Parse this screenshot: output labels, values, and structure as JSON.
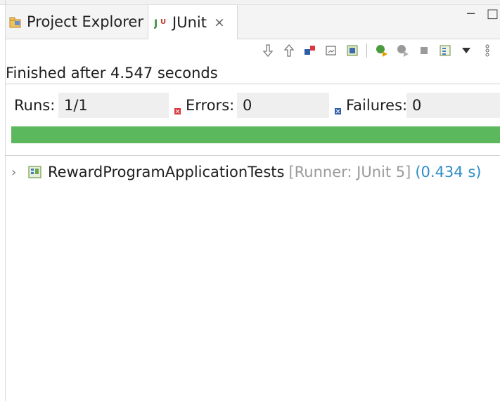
{
  "tabs": [
    {
      "label": "Project Explorer",
      "icon": "project-explorer-icon",
      "active": false
    },
    {
      "label": "JUnit",
      "icon": "junit-icon",
      "active": true,
      "close_glyph": "×"
    }
  ],
  "window_controls": {
    "minimize": "−",
    "maximize": "□"
  },
  "toolbar": {
    "icons": [
      "next-failure-icon",
      "previous-failure-icon",
      "show-failures-only-icon",
      "scroll-lock-icon",
      "show-skipped-icon",
      "rerun-test-icon",
      "rerun-failed-first-icon",
      "stop-icon",
      "test-run-history-icon",
      "view-menu-icon",
      "more-icon"
    ]
  },
  "status": {
    "text": "Finished after 4.547 seconds"
  },
  "counters": {
    "runs_label": "Runs:",
    "runs_value": "1/1",
    "errors_label": "Errors:",
    "errors_value": "0",
    "failures_label": "Failures:",
    "failures_value": "0"
  },
  "progress": {
    "fraction": 1.0,
    "color": "#5cb85c"
  },
  "tree": {
    "items": [
      {
        "name": "RewardProgramApplicationTests",
        "runner": "[Runner: JUnit 5]",
        "duration": "(0.434 s)",
        "expanded": false
      }
    ]
  },
  "colors": {
    "success": "#5cb85c",
    "duration": "#2f8fc4",
    "runner": "#9a9a9a"
  }
}
